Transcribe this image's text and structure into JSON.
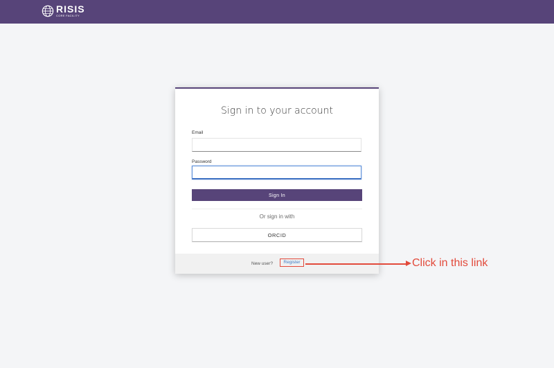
{
  "header": {
    "logo_main": "RISIS",
    "logo_sub": "CORE FACILITY",
    "logo_icon": "globe-icon",
    "bar_color": "#574479"
  },
  "login": {
    "title": "Sign in to your account",
    "email_label": "Email",
    "email_value": "",
    "password_label": "Password",
    "password_value": "",
    "signin_label": "Sign In",
    "or_text": "Or sign in with",
    "orcid_label": "ORCID",
    "new_user_text": "New user?",
    "register_label": "Register",
    "accent_color": "#574479",
    "link_color": "#3c7cc6"
  },
  "annotation": {
    "text": "Click in this link",
    "color": "#e24a3b"
  }
}
